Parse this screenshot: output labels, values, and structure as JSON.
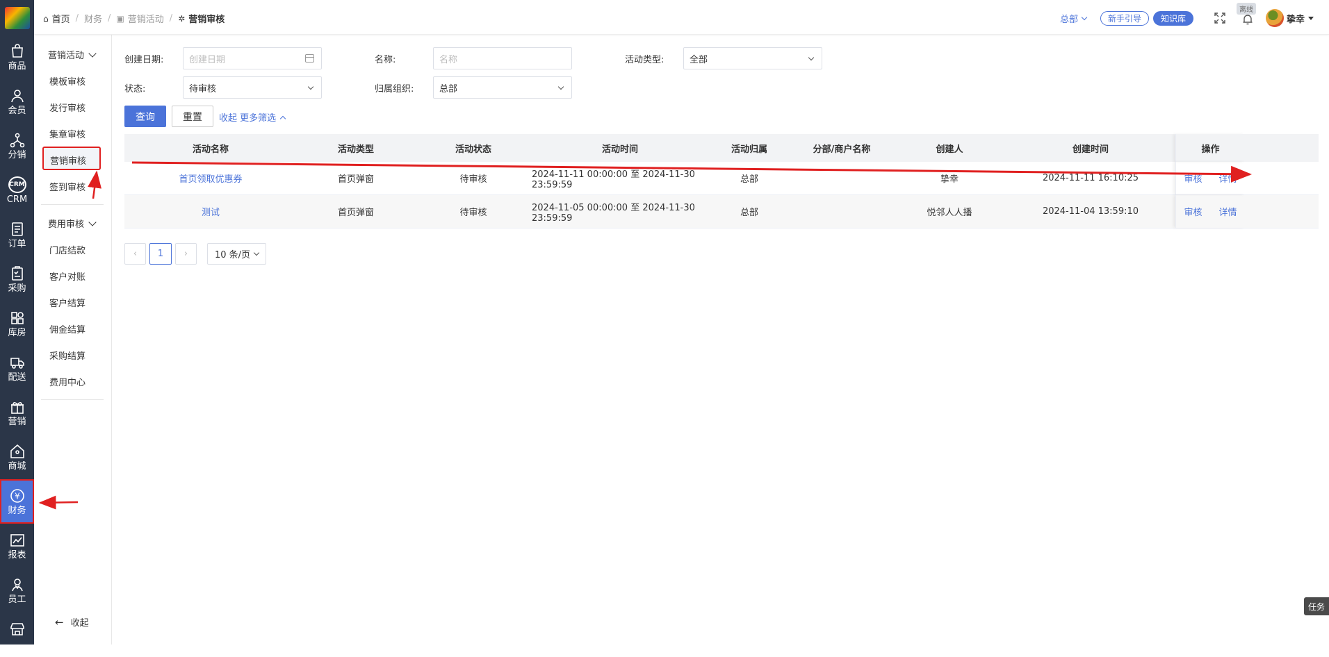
{
  "rail": {
    "items": [
      {
        "label": "商品",
        "icon": "shopping-bag-icon"
      },
      {
        "label": "会员",
        "icon": "user-icon"
      },
      {
        "label": "分销",
        "icon": "network-icon"
      },
      {
        "label": "CRM",
        "icon": "crm-icon"
      },
      {
        "label": "订单",
        "icon": "order-icon"
      },
      {
        "label": "采购",
        "icon": "clipboard-icon"
      },
      {
        "label": "库房",
        "icon": "grid-icon"
      },
      {
        "label": "配送",
        "icon": "truck-icon"
      },
      {
        "label": "营销",
        "icon": "gift-icon"
      },
      {
        "label": "商城",
        "icon": "home-icon"
      },
      {
        "label": "财务",
        "icon": "yen-icon"
      },
      {
        "label": "报表",
        "icon": "chart-icon"
      },
      {
        "label": "员工",
        "icon": "staff-icon"
      }
    ],
    "crm_badge": "CRM",
    "yen_glyph": "¥"
  },
  "submenu": {
    "group1": "营销活动",
    "group1_items": [
      "模板审核",
      "发行审核",
      "集章审核",
      "营销审核",
      "签到审核"
    ],
    "group2": "费用审核",
    "group2_items": [
      "门店结款",
      "客户对账",
      "客户结算",
      "佣金结算",
      "采购结算",
      "费用中心"
    ],
    "collapse": "收起"
  },
  "header": {
    "breadcrumb": [
      "首页",
      "财务",
      "营销活动",
      "营销审核"
    ],
    "org": "总部",
    "guide_btn": "新手引导",
    "kb_btn": "知识库",
    "offline": "离线",
    "username": "挚幸"
  },
  "filters": {
    "date_label": "创建日期:",
    "date_placeholder": "创建日期",
    "name_label": "名称:",
    "name_placeholder": "名称",
    "type_label": "活动类型:",
    "type_value": "全部",
    "status_label": "状态:",
    "status_value": "待审核",
    "org_label": "归属组织:",
    "org_value": "总部",
    "query_btn": "查询",
    "reset_btn": "重置",
    "more_filter": "收起 更多筛选"
  },
  "table": {
    "headers": [
      "活动名称",
      "活动类型",
      "活动状态",
      "活动时间",
      "活动归属",
      "分部/商户名称",
      "创建人",
      "创建时间",
      "操作"
    ],
    "rows": [
      {
        "name": "首页领取优惠券",
        "type": "首页弹窗",
        "status": "待审核",
        "time": "2024-11-11 00:00:00 至 2024-11-30 23:59:59",
        "owner": "总部",
        "branch": "",
        "creator": "挚幸",
        "created": "2024-11-11 16:10:25"
      },
      {
        "name": "测试",
        "type": "首页弹窗",
        "status": "待审核",
        "time": "2024-11-05 00:00:00 至 2024-11-30 23:59:59",
        "owner": "总部",
        "branch": "",
        "creator": "悦邻人人播",
        "created": "2024-11-04 13:59:10"
      }
    ],
    "op_review": "审核",
    "op_detail": "详情"
  },
  "pagination": {
    "prev": "‹",
    "current": "1",
    "next": "›",
    "page_size": "10 条/页"
  },
  "task_tab": "任务",
  "colors": {
    "primary": "#4b73d9",
    "rail_bg": "#2b3648",
    "annotation": "#e02020"
  }
}
